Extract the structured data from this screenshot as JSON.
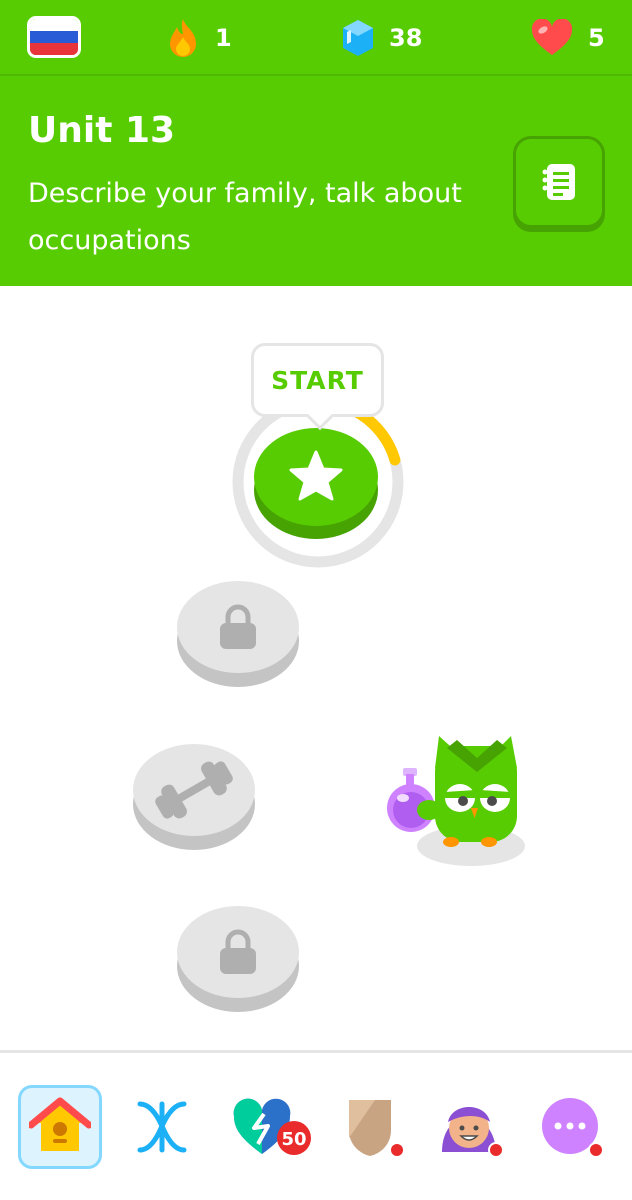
{
  "header": {
    "language_flag": "russian-flag-icon",
    "streak": {
      "icon": "fire-icon",
      "value": "1"
    },
    "gems": {
      "icon": "gem-icon",
      "value": "38"
    },
    "hearts": {
      "icon": "heart-icon",
      "value": "5"
    }
  },
  "unit": {
    "title": "Unit 13",
    "description": "Describe your family, talk about occupations",
    "guide_icon": "guidebook-icon"
  },
  "path": {
    "start_label": "START",
    "current_lesson_progress": 0.15,
    "nodes": [
      {
        "state": "current",
        "icon": "star-icon"
      },
      {
        "state": "locked",
        "icon": "lock-icon"
      },
      {
        "state": "practice",
        "icon": "dumbbell-icon"
      },
      {
        "state": "locked",
        "icon": "lock-icon"
      }
    ],
    "mascot": "owl-with-potion-icon"
  },
  "nav": {
    "items": [
      {
        "icon": "home-icon",
        "active": true
      },
      {
        "icon": "letters-icon",
        "active": false
      },
      {
        "icon": "league-icon",
        "badge": "50"
      },
      {
        "icon": "shop-icon",
        "notification": true
      },
      {
        "icon": "profile-icon",
        "notification": true
      },
      {
        "icon": "more-icon",
        "notification": true
      }
    ]
  },
  "colors": {
    "brand_green": "#58cc02",
    "progress_gold": "#ffc800",
    "locked_gray": "#e5e5e5"
  }
}
